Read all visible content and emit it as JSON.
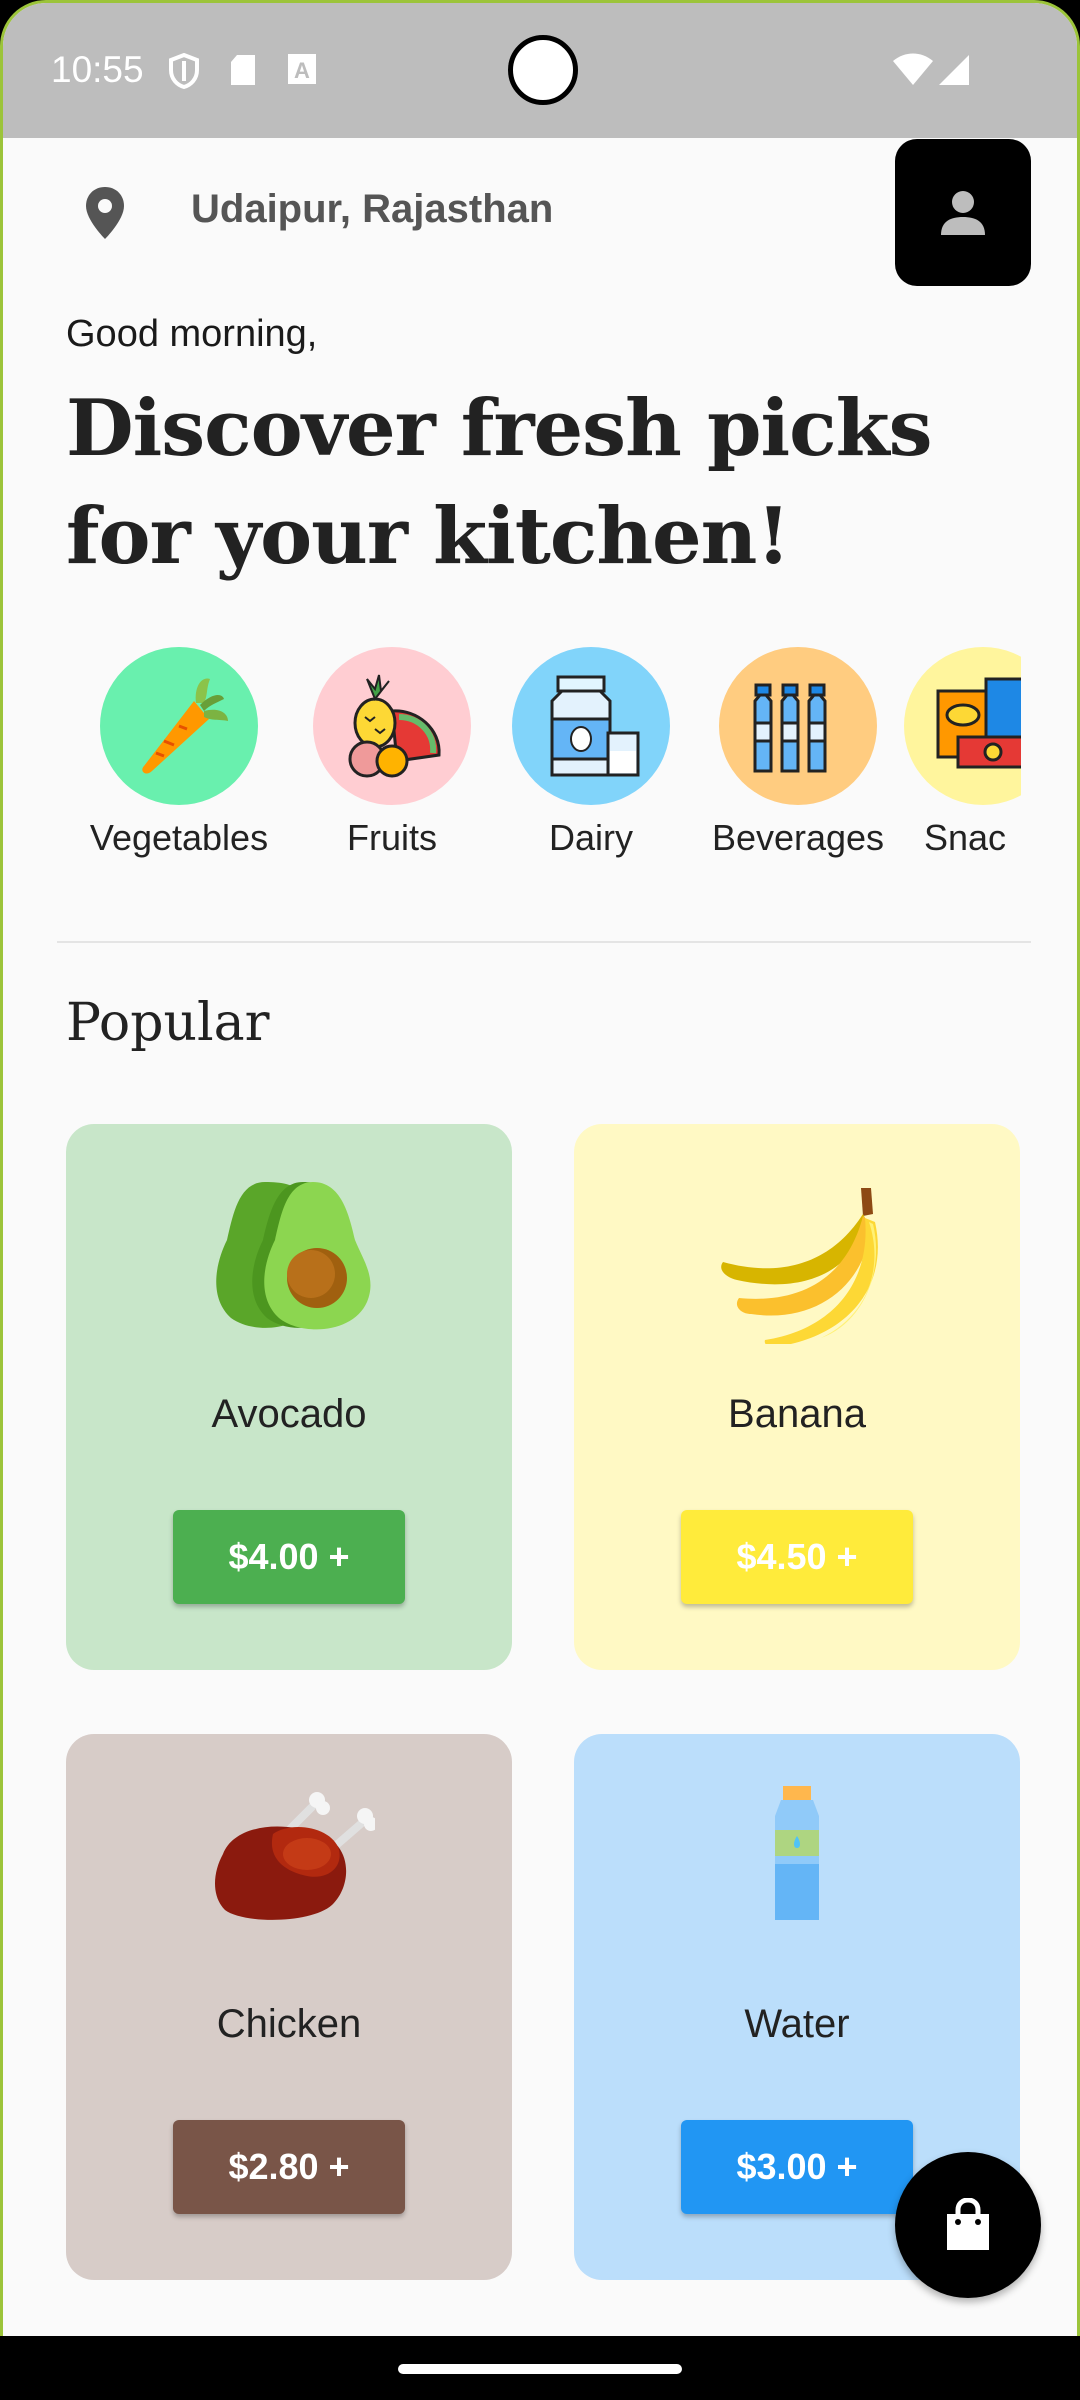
{
  "status_bar": {
    "time": "10:55",
    "icons": [
      "shield-icon",
      "sd-card-icon",
      "a-icon",
      "wifi-icon",
      "signal-icon"
    ]
  },
  "header": {
    "location": "Udaipur, Rajasthan",
    "location_icon": "location-pin-icon",
    "profile_icon": "person-icon"
  },
  "greeting": "Good morning,",
  "headline": "Discover fresh picks for your kitchen!",
  "categories": [
    {
      "label": "Vegetables",
      "icon": "carrot-icon",
      "color": "#69f0ae"
    },
    {
      "label": "Fruits",
      "icon": "fruits-icon",
      "color": "#ffcdd2"
    },
    {
      "label": "Dairy",
      "icon": "milk-icon",
      "color": "#81d4fa"
    },
    {
      "label": "Beverages",
      "icon": "bottles-icon",
      "color": "#ffcc80"
    },
    {
      "label": "Snac",
      "icon": "snacks-icon",
      "color": "#fff59d"
    }
  ],
  "popular": {
    "title": "Popular",
    "items": [
      {
        "name": "Avocado",
        "price": "$4.00 +",
        "bg": "#c8e6c9",
        "button_color": "#4caf50",
        "icon": "avocado-icon"
      },
      {
        "name": "Banana",
        "price": "$4.50 +",
        "bg": "#fff9c4",
        "button_color": "#ffeb3b",
        "icon": "banana-icon"
      },
      {
        "name": "Chicken",
        "price": "$2.80 +",
        "bg": "#d7ccc8",
        "button_color": "#795548",
        "icon": "chicken-icon"
      },
      {
        "name": "Water",
        "price": "$3.00 +",
        "bg": "#bbdefb",
        "button_color": "#2196f3",
        "icon": "water-bottle-icon"
      }
    ]
  },
  "fab_icon": "shopping-bag-icon"
}
